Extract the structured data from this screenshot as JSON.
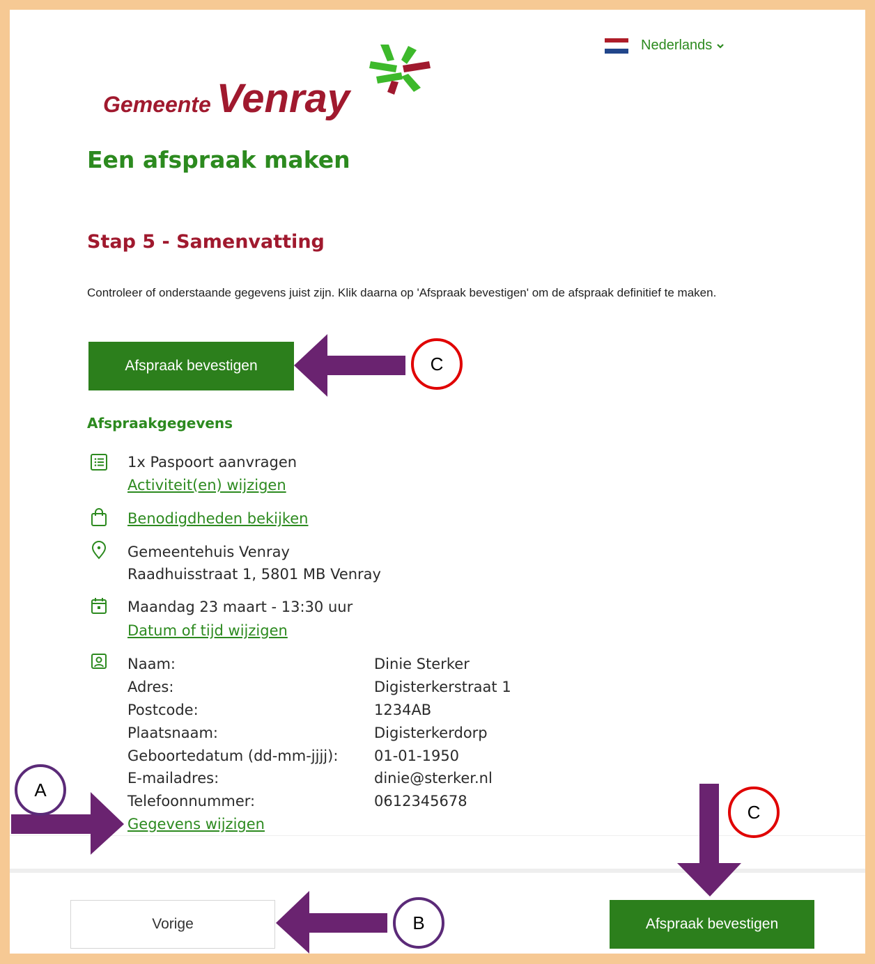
{
  "language": {
    "label": "Nederlands",
    "flag_colors": [
      "#ae1c28",
      "#ffffff",
      "#21468b"
    ]
  },
  "logo": {
    "word1": "Gemeente",
    "word2": "Venray",
    "color": "#a0192e",
    "accent": "#3db92b"
  },
  "page_title": "Een afspraak maken",
  "step_title": "Stap 5 - Samenvatting",
  "intro": "Controleer of onderstaande gegevens juist zijn. Klik daarna op 'Afspraak bevestigen' om de afspraak definitief te maken.",
  "confirm_label": "Afspraak bevestigen",
  "section_title": "Afspraakgegevens",
  "activity": {
    "text": "1x Paspoort aanvragen",
    "link": "Activiteit(en) wijzigen"
  },
  "requirements_link": "Benodigdheden bekijken",
  "location": {
    "name": "Gemeentehuis Venray",
    "address": "Raadhuisstraat 1, 5801 MB Venray"
  },
  "datetime": {
    "text": "Maandag 23 maart - 13:30 uur",
    "link": "Datum of tijd wijzigen"
  },
  "person": {
    "rows": [
      {
        "label": "Naam:",
        "value": "Dinie Sterker"
      },
      {
        "label": "Adres:",
        "value": "Digisterkerstraat 1"
      },
      {
        "label": "Postcode:",
        "value": "1234AB"
      },
      {
        "label": "Plaatsnaam:",
        "value": "Digisterkerdorp"
      },
      {
        "label": "Geboortedatum (dd-mm-jjjj):",
        "value": "01-01-1950"
      },
      {
        "label": "E-mailadres:",
        "value": "dinie@sterker.nl"
      },
      {
        "label": "Telefoonnummer:",
        "value": "0612345678"
      }
    ],
    "link": "Gegevens wijzigen"
  },
  "footer": {
    "back_label": "Vorige",
    "confirm_label": "Afspraak bevestigen"
  },
  "annotations": {
    "a": "A",
    "b": "B",
    "c": "C",
    "arrow_color": "#6a2370"
  },
  "colors": {
    "green": "#2c8a1f",
    "button_green": "#2c7f1c",
    "red": "#a0192e",
    "frame": "#f6c994"
  }
}
